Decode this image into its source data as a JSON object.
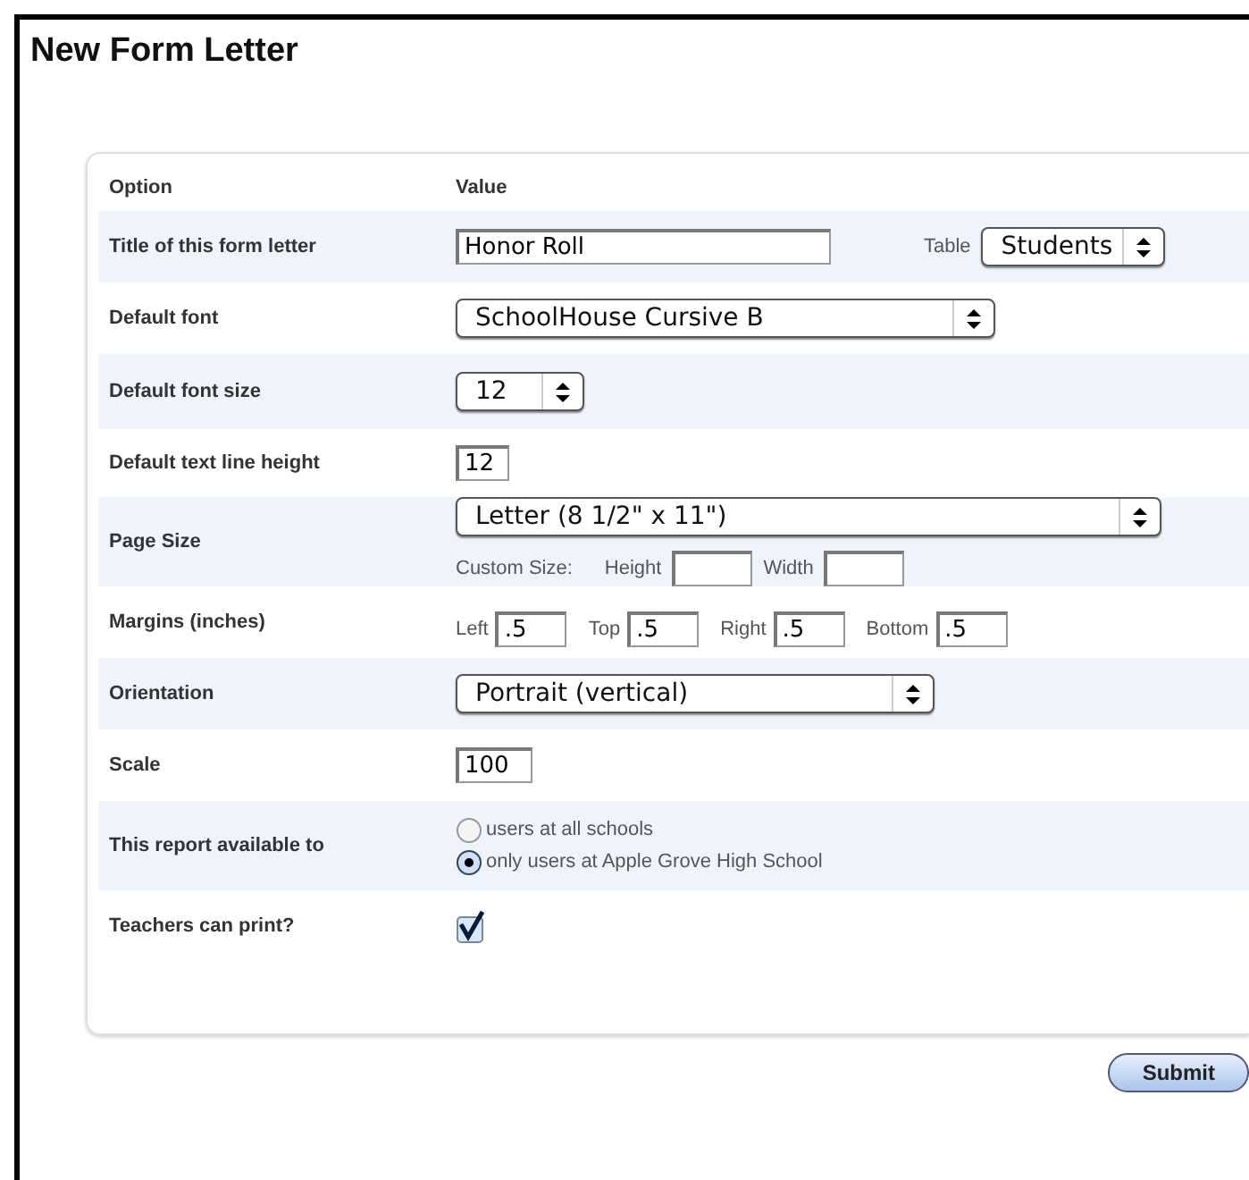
{
  "title": "New Form Letter",
  "columns": [
    "Option",
    "Value"
  ],
  "rows": [
    {
      "kind": "input-select",
      "label": "Title of this form letter",
      "value": "Honor Roll",
      "extra_label": "Table",
      "select": "Students"
    },
    {
      "kind": "select",
      "label": "Default font",
      "select": "SchoolHouse Cursive B"
    },
    {
      "kind": "select",
      "label": "Default font size",
      "select": "12"
    },
    {
      "kind": "input",
      "label": "Default text line height",
      "value": "12"
    },
    {
      "kind": "page-size",
      "label": "Page Size",
      "select": "Letter (8 1/2\" x 11\")",
      "custom_label": "Custom Size:",
      "fields": [
        {
          "label": "Height"
        },
        {
          "label": "Width"
        }
      ]
    },
    {
      "kind": "fields",
      "label": "Margins (inches)",
      "fields": [
        {
          "label": "Left",
          "value": ".5"
        },
        {
          "label": "Top",
          "value": ".5"
        },
        {
          "label": "Right",
          "value": ".5"
        },
        {
          "label": "Bottom",
          "value": ".5"
        }
      ]
    },
    {
      "kind": "select",
      "label": "Orientation",
      "select": "Portrait (vertical)"
    },
    {
      "kind": "input",
      "label": "Scale",
      "value": "100"
    },
    {
      "kind": "radio",
      "label": "This report available to",
      "options": [
        {
          "label": "users at all schools",
          "selected": false
        },
        {
          "label": "only users at Apple Grove High School",
          "selected": true
        }
      ]
    },
    {
      "kind": "checkbox",
      "label": "Teachers can print?",
      "checked": true
    }
  ],
  "submit": "Submit"
}
